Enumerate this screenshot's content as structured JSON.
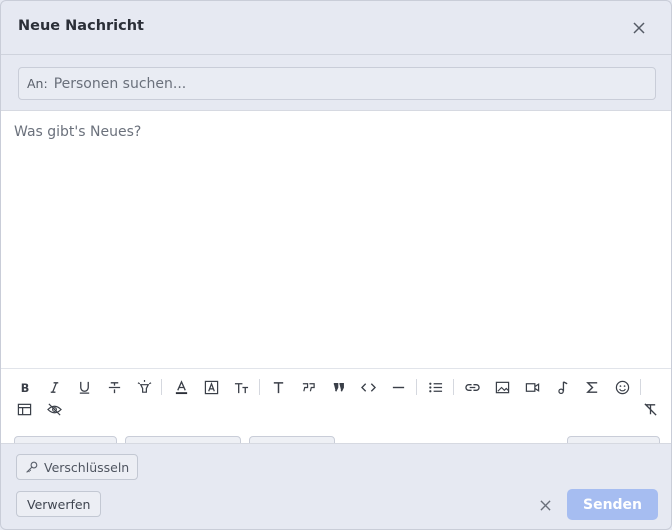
{
  "dialog": {
    "title": "Neue Nachricht"
  },
  "recipients": {
    "label": "An:",
    "placeholder": "Personen suchen..."
  },
  "editor": {
    "placeholder": "Was gibt's Neues?"
  },
  "toolbar": {
    "items": [
      "bold-icon",
      "italic-icon",
      "underline-icon",
      "strikethrough-icon",
      "highlight-icon",
      "text-color-icon",
      "background-color-icon",
      "font-size-icon",
      "heading-icon",
      "blockquote-icon",
      "quote-icon",
      "code-icon",
      "horizontal-rule-icon",
      "bullet-list-icon",
      "link-icon",
      "image-icon",
      "video-icon",
      "audio-icon",
      "math-icon",
      "emoji-icon",
      "table-icon",
      "spoiler-icon",
      "clear-format-icon"
    ]
  },
  "footer": {
    "encrypt_label": "Verschlüsseln",
    "discard_label": "Verwerfen",
    "send_label": "Senden"
  },
  "colors": {
    "background": "#e6e9f2",
    "editor": "#ffffff",
    "send_button": "#a6bdf1",
    "text_color_underline": "#2b2f38"
  }
}
